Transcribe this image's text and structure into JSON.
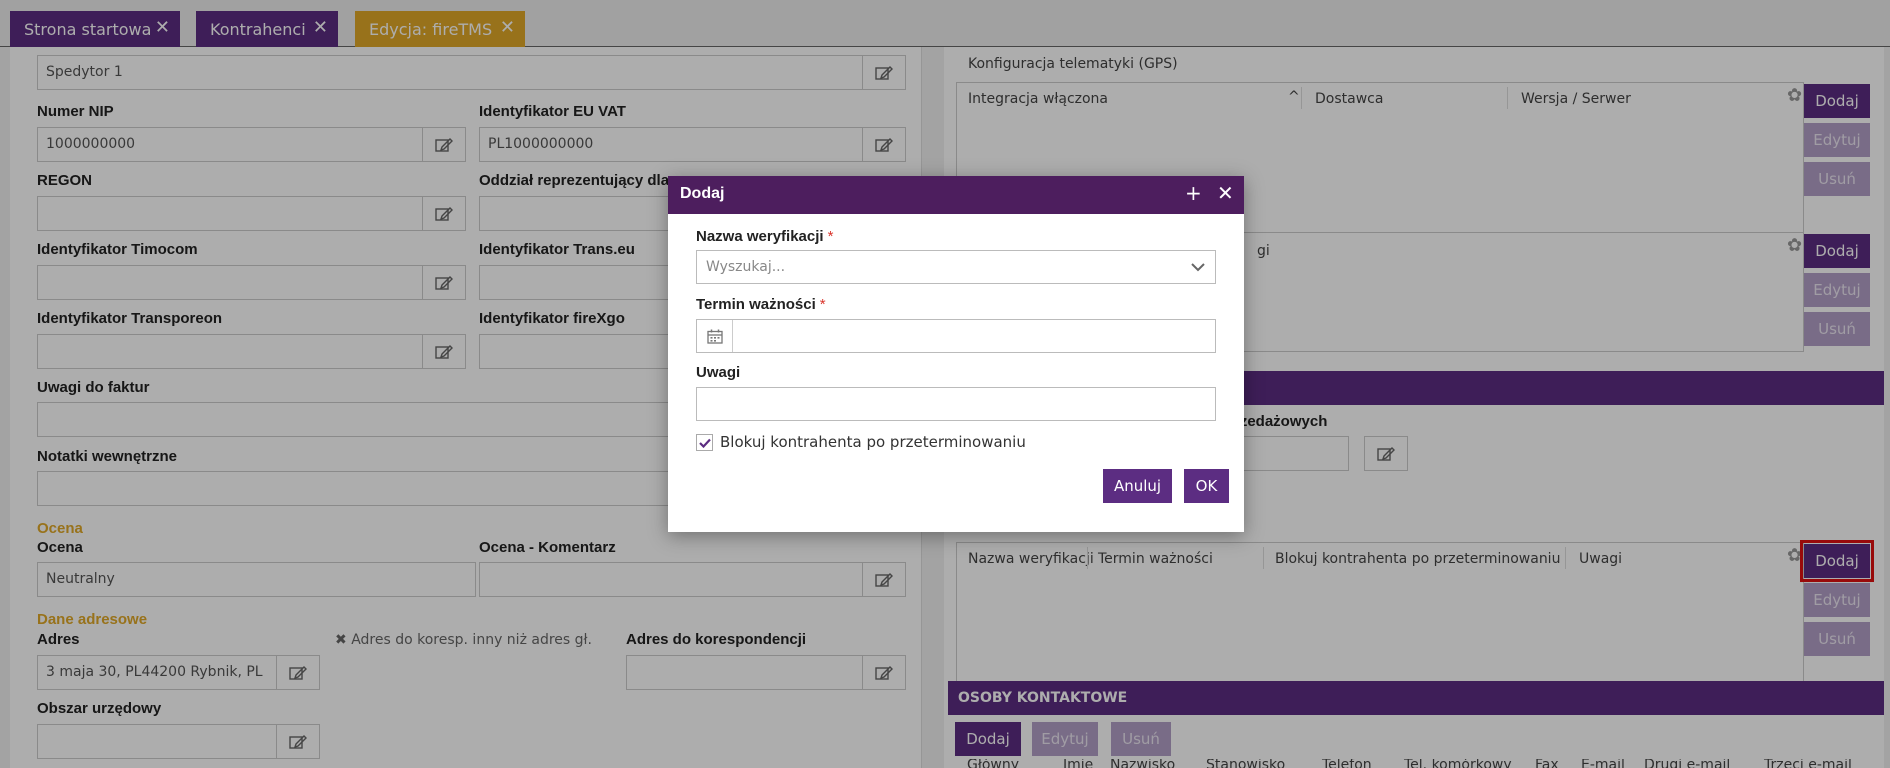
{
  "tabs": [
    {
      "label": "Strona startowa"
    },
    {
      "label": "Kontrahenci"
    },
    {
      "label": "Edycja: fireTMS"
    }
  ],
  "left": {
    "spedytor_value": "Spedytor 1",
    "nip_label": "Numer NIP",
    "nip_value": "1000000000",
    "euvat_label": "Identyfikator EU VAT",
    "euvat_value": "PL1000000000",
    "regon_label": "REGON",
    "oddzial_label": "Oddział reprezentujący dla",
    "timocom_label": "Identyfikator Timocom",
    "transeu_label": "Identyfikator Trans.eu",
    "transporeon_label": "Identyfikator Transporeon",
    "firexgo_label": "Identyfikator fireXgo",
    "uwagi_faktur_label": "Uwagi do faktur",
    "notatki_label": "Notatki wewnętrzne",
    "ocena_section": "Ocena",
    "ocena_label": "Ocena",
    "ocena_value": "Neutralny",
    "ocena_kom_label": "Ocena - Komentarz",
    "dane_section": "Dane adresowe",
    "adres_label": "Adres",
    "adres_value": "3 maja 30, PL44200 Rybnik, PL",
    "adres_koresp_check": "Adres do koresp. inny niż adres gł.",
    "adres_koresp_label": "Adres do korespondencji",
    "obszar_label": "Obszar urzędowy"
  },
  "right": {
    "gps_title": "Konfiguracja telematyki (GPS)",
    "gps_cols": [
      "Integracja włączona",
      "Dostawca",
      "Wersja / Serwer"
    ],
    "box2_partial": "gi",
    "sprzedaz_partial": "rzedażowych",
    "verif_cols": [
      "Nazwa weryfikacji",
      "Termin ważności",
      "Blokuj kontrahenta po przeterminowaniu",
      "Uwagi"
    ],
    "btn_add": "Dodaj",
    "btn_edit": "Edytuj",
    "btn_delete": "Usuń",
    "contacts_title": "OSOBY KONTAKTOWE",
    "contacts_cols": [
      "Główny",
      "Imię",
      "Nazwisko",
      "Stanowisko",
      "Telefon",
      "Tel. komórkowy",
      "Fax",
      "E-mail",
      "Drugi e-mail",
      "Trzeci e-mail"
    ]
  },
  "modal": {
    "title": "Dodaj",
    "name_label": "Nazwa weryfikacji",
    "name_placeholder": "Wyszukaj...",
    "term_label": "Termin ważności",
    "notes_label": "Uwagi",
    "block_label": "Blokuj kontrahenta po przeterminowaniu",
    "block_checked": true,
    "cancel": "Anuluj",
    "ok": "OK",
    "required_mark": "*"
  },
  "colors": {
    "primary": "#5c2d82",
    "modal_header": "#4d1e5e",
    "accent_tab": "#e0a928",
    "section": "#e0a928",
    "highlight": "#e01010"
  },
  "icons": {
    "edit": "edit-icon",
    "gear": "gear-icon",
    "calendar": "calendar-icon",
    "chevron": "chevron-down-icon",
    "plus": "plus-icon",
    "close": "close-icon",
    "check": "check-icon",
    "sort": "sort-up-icon"
  }
}
